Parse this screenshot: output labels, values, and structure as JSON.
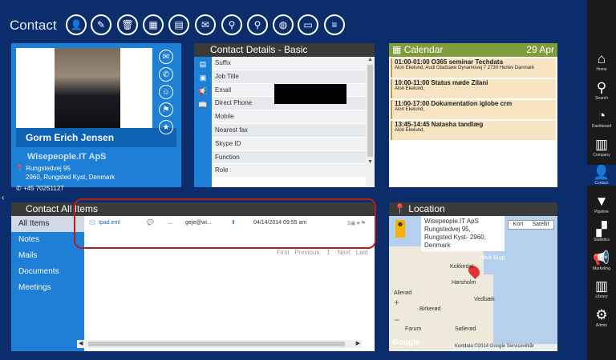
{
  "app": {
    "title": "Contact"
  },
  "profile": {
    "name": "Gorm Erich Jensen",
    "company": "Wisepeople.IT ApS",
    "address1": "Rungstedvej 95",
    "address2": "2960, Rungsted Kyst, Denmark",
    "phone": "+45 70251127"
  },
  "contact_details": {
    "title": "Contact Details - Basic",
    "fields": [
      "Suffix",
      "Job Title",
      "Email",
      "Direct Phone",
      "Mobile",
      "Nearest fax",
      "Skype ID",
      "Function",
      "Role"
    ]
  },
  "calendar": {
    "title": "Calendar",
    "date": "29 Apr",
    "events": [
      {
        "time": "01:00-01:00 O365 seminar Techdata",
        "detail": "Alon Ekelund, Audi Gladsaxe Dynamovej 7 2730 Herlev Danmark"
      },
      {
        "time": "10:00-11:00 Status møde Zilani",
        "detail": "Alon Ekelund,"
      },
      {
        "time": "11:00-17:00 Dokumentation iglobe crm",
        "detail": "Alon Ekelund,"
      },
      {
        "time": "13:45-14:45 Natasha tandlæg",
        "detail": "Alon Ekelund,"
      }
    ]
  },
  "all_items": {
    "title": "Contact All Items",
    "nav": [
      "All Items",
      "Notes",
      "Mails",
      "Documents",
      "Meetings"
    ],
    "row": {
      "file": "Ipad.eml",
      "dots": "...",
      "email": "geje@wi...",
      "date": "04/14/2014 09:55 am"
    },
    "pager": {
      "first": "First",
      "previous": "Previous",
      "page": "1",
      "next": "Next",
      "last": "Last"
    }
  },
  "location": {
    "title": "Location",
    "popup_line1": "Wisepeople.IT ApS",
    "popup_line2": "Rungstedvej 95,",
    "popup_line3": "Rungsted Kyst- 2960,",
    "popup_line4": "Denmark",
    "map_btn1": "Kort",
    "map_btn2": "Satellit",
    "places": [
      "Nivå Bugt",
      "Kokkedal",
      "Hørsholm",
      "Vedbæk",
      "Birkerød",
      "Søllerød",
      "Farum",
      "Allerød"
    ],
    "attribution": "Kortdata ©2014 Google   Servicevilkår",
    "google": "Google"
  },
  "sidebar": {
    "items": [
      "Home",
      "Search",
      "Dashboard",
      "Company",
      "Contact",
      "Pipeline",
      "Statistics",
      "Marketing",
      "Library",
      "Admin"
    ]
  }
}
